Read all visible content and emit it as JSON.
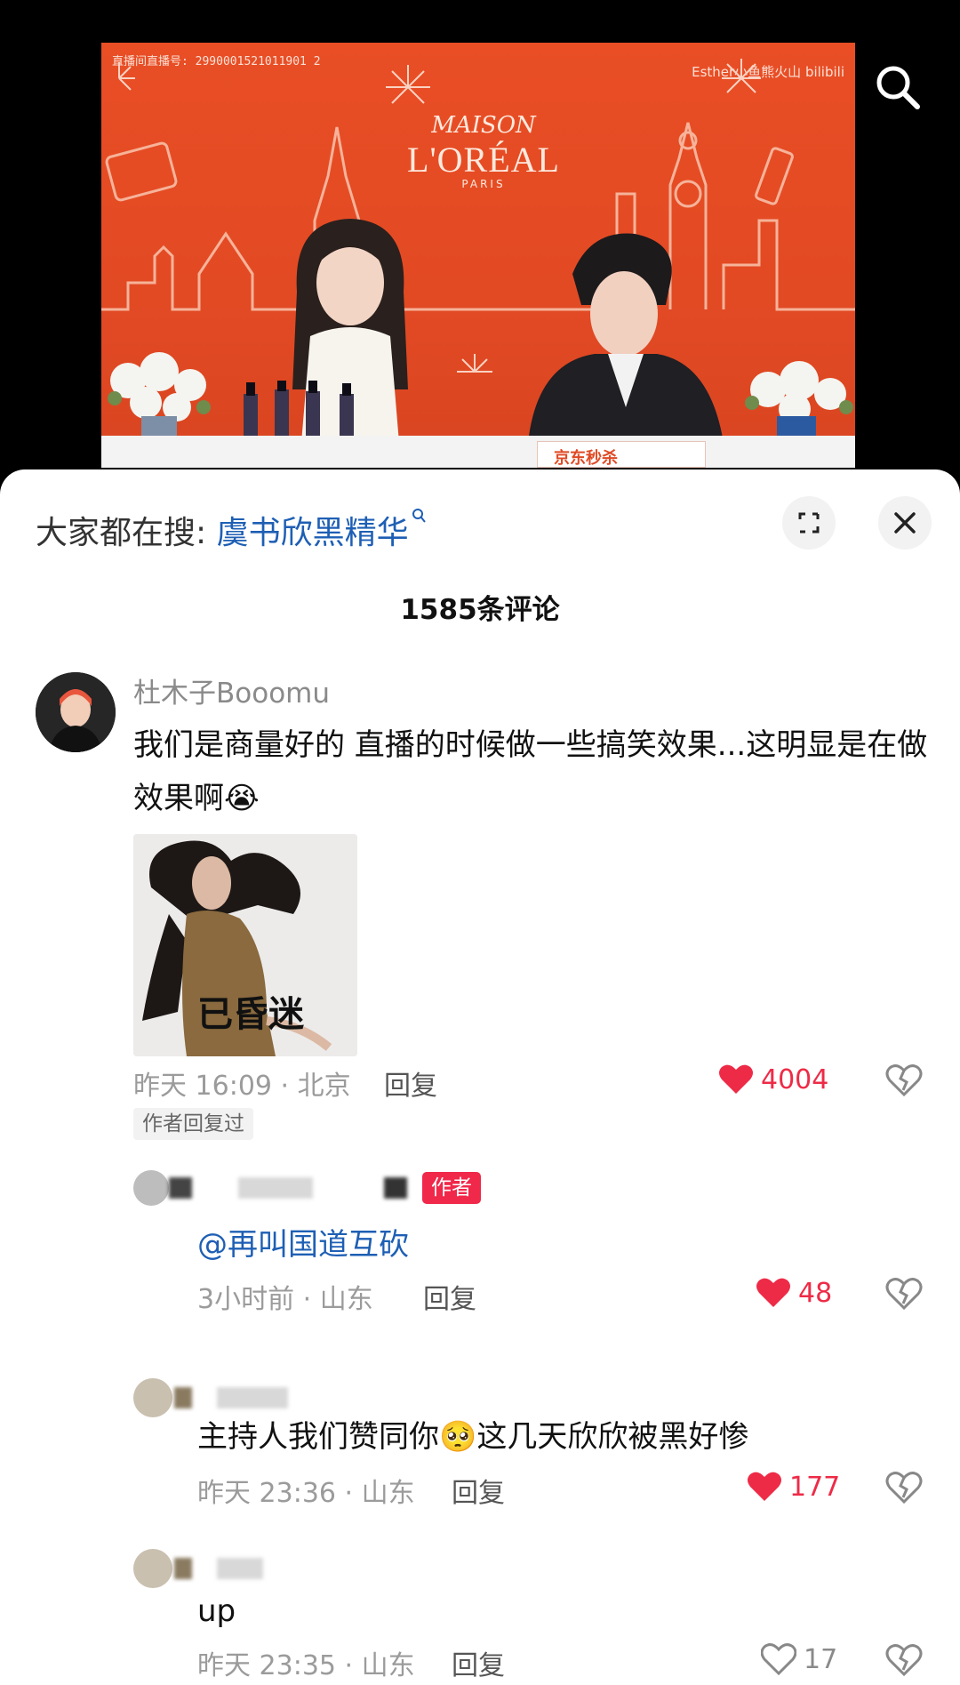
{
  "video": {
    "room_id": "直播间直播号: 2990001521011901 2",
    "watermark": "Esther小鱼熊火山 bilibili",
    "brand_top": "MAISON",
    "brand_main": "L'ORÉAL",
    "brand_sub": "PARIS",
    "sign_text": "京东秒杀"
  },
  "header": {
    "hot_search_prefix": "大家都在搜: ",
    "hot_search_keyword": "虞书欣黑精华"
  },
  "comments_header": {
    "count_label": "1585条评论"
  },
  "comments": [
    {
      "username": "杜木子Booomu",
      "text": "我们是商量好的 直播的时候做一些搞笑效果...这明显是在做效果啊😭",
      "image_caption": "已昏迷",
      "meta": "昨天 16:09 · 北京",
      "reply_label": "回复",
      "likes": "4004",
      "author_replied_tag": "作者回复过"
    }
  ],
  "replies": [
    {
      "badge": "作者",
      "text": "@再叫国道互砍",
      "meta": "3小时前 · 山东",
      "reply_label": "回复",
      "likes": "48"
    },
    {
      "text": "主持人我们赞同你🥺这几天欣欣被黑好惨",
      "meta": "昨天 23:36 · 山东",
      "reply_label": "回复",
      "likes": "177"
    },
    {
      "text": "up",
      "meta": "昨天 23:35 · 山东",
      "reply_label": "回复",
      "likes": "17"
    }
  ],
  "colors": {
    "accent_red": "#ee2b47",
    "link_blue": "#1e5fb4",
    "video_bg": "#e94e25"
  },
  "icons": [
    "search-icon",
    "expand-icon",
    "close-icon",
    "heart-icon",
    "broken-heart-icon"
  ]
}
